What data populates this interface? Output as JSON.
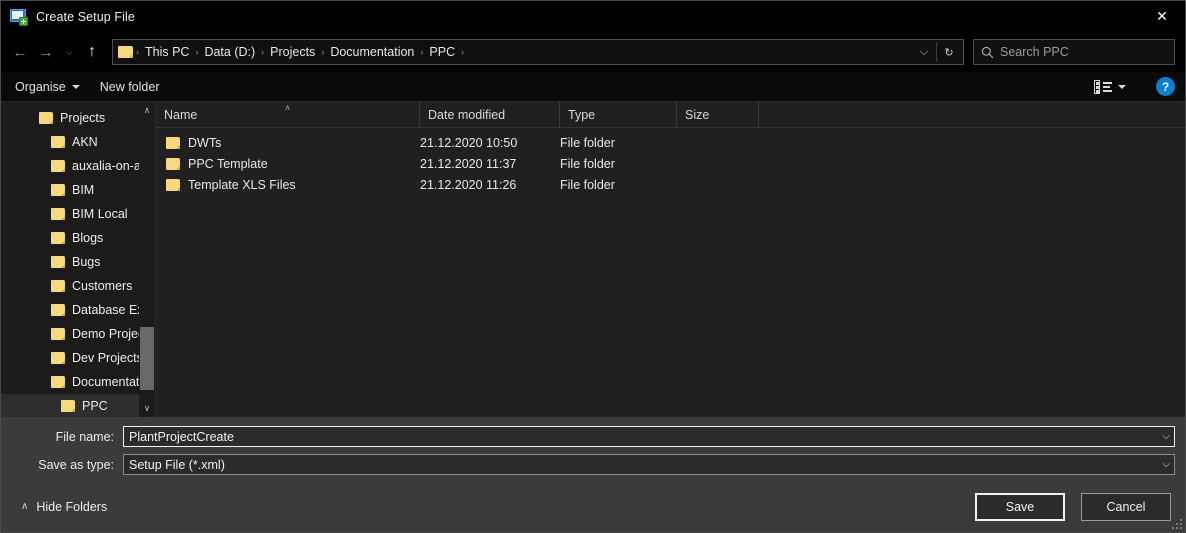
{
  "window": {
    "title": "Create Setup File",
    "icon": "create-setup-file-icon",
    "close_label": "✕"
  },
  "nav": {
    "back": "←",
    "forward": "→",
    "recent": "⌵",
    "up": "↑"
  },
  "address": {
    "breadcrumbs": [
      "This PC",
      "Data (D:)",
      "Projects",
      "Documentation",
      "PPC"
    ],
    "separator": "›",
    "dropdown": "⌵",
    "refresh": "↻"
  },
  "search": {
    "placeholder": "Search PPC",
    "icon": "🔍"
  },
  "toolbar": {
    "organise_label": "Organise",
    "new_folder_label": "New folder",
    "view_icon": "list-view-icon",
    "view_caret": "▾",
    "help_label": "?"
  },
  "sidebar": {
    "items": [
      {
        "label": "Projects",
        "indent": 0,
        "selected": false
      },
      {
        "label": "AKN",
        "indent": 1,
        "selected": false
      },
      {
        "label": "auxalia-on-ai",
        "indent": 1,
        "selected": false
      },
      {
        "label": "BIM",
        "indent": 1,
        "selected": false
      },
      {
        "label": "BIM Local",
        "indent": 1,
        "selected": false
      },
      {
        "label": "Blogs",
        "indent": 1,
        "selected": false
      },
      {
        "label": "Bugs",
        "indent": 1,
        "selected": false
      },
      {
        "label": "Customers",
        "indent": 1,
        "selected": false
      },
      {
        "label": "Database Exp",
        "indent": 1,
        "selected": false
      },
      {
        "label": "Demo Project",
        "indent": 1,
        "selected": false
      },
      {
        "label": "Dev Projects",
        "indent": 1,
        "selected": false
      },
      {
        "label": "Documentati",
        "indent": 1,
        "selected": false
      },
      {
        "label": "PPC",
        "indent": 2,
        "selected": true
      }
    ],
    "scroll_up": "∧",
    "scroll_down": "∨"
  },
  "filelist": {
    "columns": [
      "Name",
      "Date modified",
      "Type",
      "Size"
    ],
    "sort_caret": "∧",
    "rows": [
      {
        "name": "DWTs",
        "date": "21.12.2020 10:50",
        "type": "File folder",
        "size": ""
      },
      {
        "name": "PPC Template",
        "date": "21.12.2020 11:37",
        "type": "File folder",
        "size": ""
      },
      {
        "name": "Template XLS Files",
        "date": "21.12.2020 11:26",
        "type": "File folder",
        "size": ""
      }
    ]
  },
  "footer": {
    "file_name_label": "File name:",
    "file_name_value": "PlantProjectCreate",
    "save_as_type_label": "Save as type:",
    "save_as_type_value": "Setup File  (*.xml)",
    "combo_arrow": "⌵",
    "hide_folders_label": "Hide Folders",
    "hide_folders_chevron": "∧",
    "save_label": "Save",
    "cancel_label": "Cancel"
  },
  "colors": {
    "accent": "#0b7fd4",
    "folder": "#f5d97a",
    "window_bg": "#1b1b1b",
    "list_bg": "#202020",
    "footer_bg": "#3b3b3b"
  }
}
